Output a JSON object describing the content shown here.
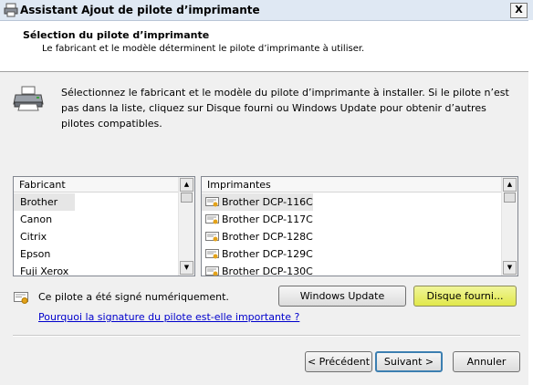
{
  "window": {
    "title": "Assistant Ajout de pilote d’imprimante",
    "close_label": "X"
  },
  "header": {
    "title": "Sélection du pilote d’imprimante",
    "subtitle": "Le fabricant et le modèle déterminent le pilote d’imprimante à utiliser."
  },
  "intro": {
    "text": "Sélectionnez le fabricant et le modèle du pilote d’imprimante à installer. Si le pilote n’est pas dans la liste, cliquez sur Disque fourni ou Windows Update pour obtenir d’autres pilotes compatibles."
  },
  "manufacturers": {
    "header": "Fabricant",
    "items": [
      "Brother",
      "Canon",
      "Citrix",
      "Epson",
      "Fuji Xerox"
    ],
    "selected": "Brother"
  },
  "printers": {
    "header": "Imprimantes",
    "items": [
      "Brother DCP-116C",
      "Brother DCP-117C",
      "Brother DCP-128C",
      "Brother DCP-129C",
      "Brother DCP-130C"
    ],
    "selected": "Brother DCP-116C"
  },
  "signature": {
    "text": "Ce pilote a été signé numériquement.",
    "link": "Pourquoi la signature du pilote est-elle importante ?"
  },
  "buttons": {
    "windows_update": "Windows Update",
    "have_disk": "Disque fourni...",
    "back": "< Précédent",
    "next": "Suivant >",
    "cancel": "Annuler"
  },
  "colors": {
    "highlight": "#e1e84a",
    "link": "#0000cc",
    "default_button_border": "#3c7fb1"
  }
}
